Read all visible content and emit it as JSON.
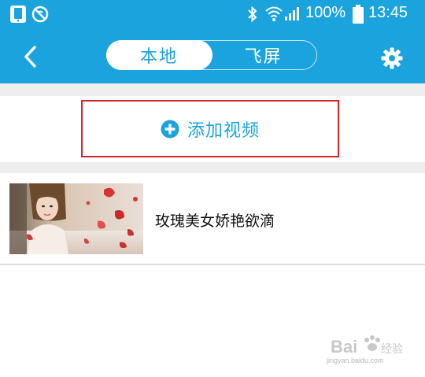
{
  "status_bar": {
    "battery_percent": "100%",
    "time": "13:45"
  },
  "header": {
    "tabs": [
      {
        "label": "本地",
        "active": true
      },
      {
        "label": "飞屏",
        "active": false
      }
    ]
  },
  "main": {
    "add_video_label": "添加视频",
    "videos": [
      {
        "title": "玫瑰美女娇艳欲滴"
      }
    ]
  },
  "watermark": {
    "url": "jingyan.baidu.com"
  },
  "colors": {
    "accent": "#1aa3dc",
    "highlight_border": "#d8232a"
  }
}
